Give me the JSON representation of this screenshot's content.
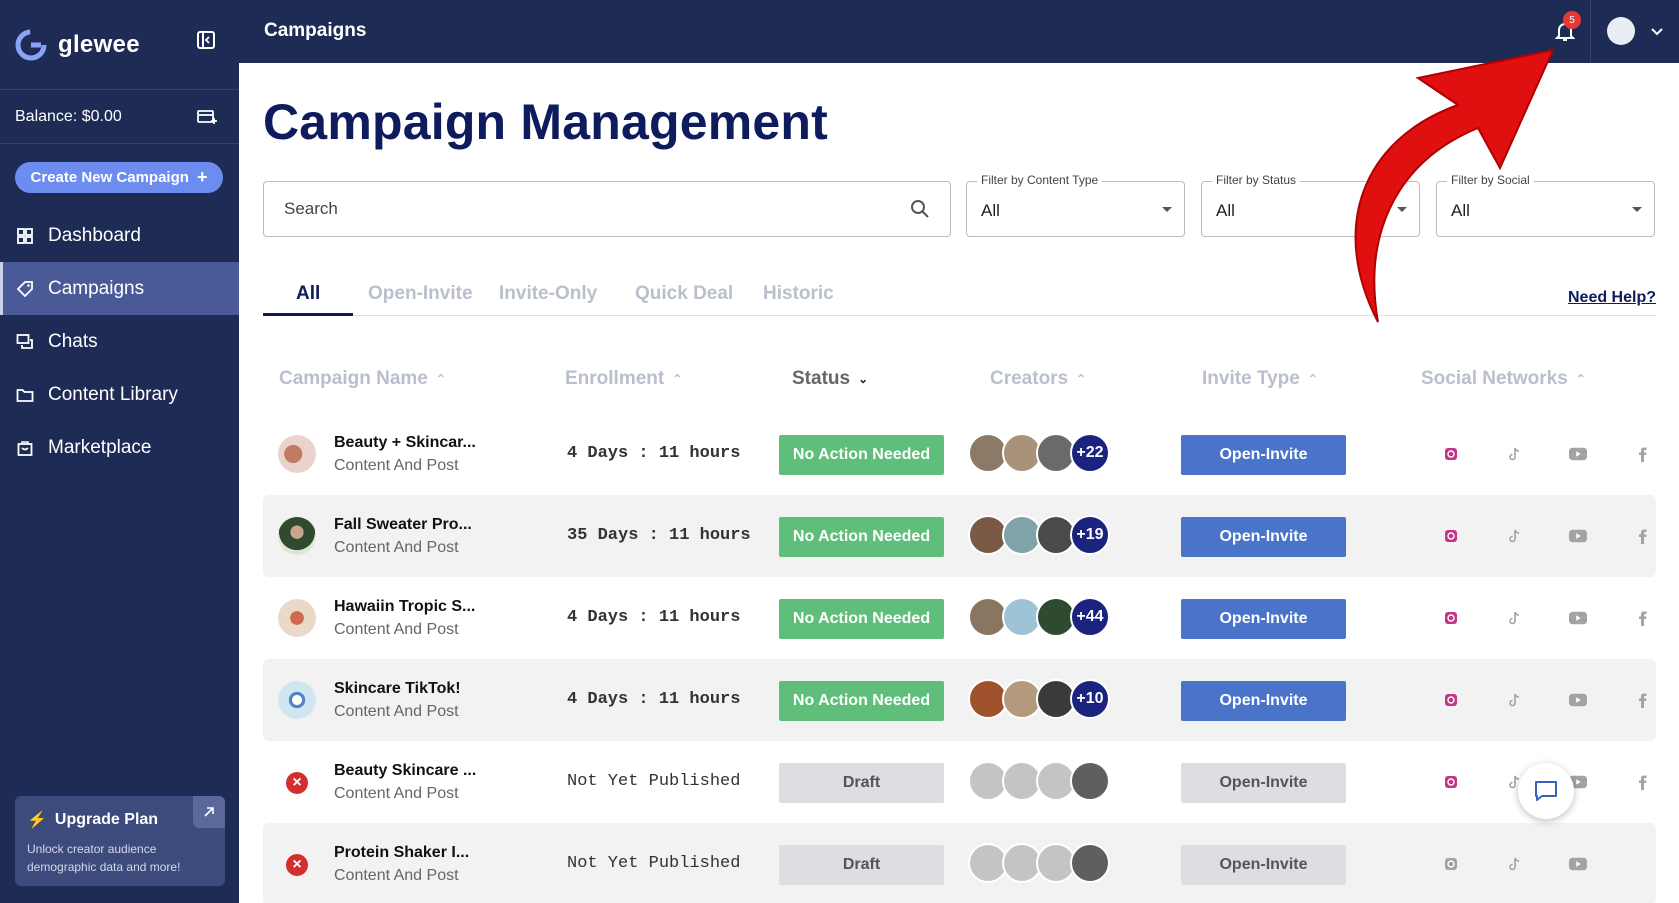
{
  "brand": {
    "name": "glewee"
  },
  "sidebar": {
    "balance": "Balance: $0.00",
    "create_label": "Create New Campaign",
    "items": [
      {
        "label": "Dashboard",
        "icon": "grid-icon"
      },
      {
        "label": "Campaigns",
        "icon": "tag-icon",
        "active": true
      },
      {
        "label": "Chats",
        "icon": "chat-icon"
      },
      {
        "label": "Content Library",
        "icon": "folder-icon"
      },
      {
        "label": "Marketplace",
        "icon": "bag-icon"
      }
    ],
    "upgrade": {
      "title": "Upgrade Plan",
      "text": "Unlock creator audience demographic data and more!"
    }
  },
  "topbar": {
    "title": "Campaigns",
    "notification_count": "5"
  },
  "main": {
    "title": "Campaign Management",
    "search": {
      "placeholder": "Search"
    },
    "filters": [
      {
        "label": "Filter by Content Type",
        "value": "All"
      },
      {
        "label": "Filter by Status",
        "value": "All"
      },
      {
        "label": "Filter by Social",
        "value": "All"
      }
    ],
    "tabs": [
      "All",
      "Open-Invite",
      "Invite-Only",
      "Quick Deal",
      "Historic"
    ],
    "help": "Need Help?",
    "columns": [
      "Campaign Name",
      "Enrollment",
      "Status",
      "Creators",
      "Invite Type",
      "Social Networks"
    ]
  },
  "rows": [
    {
      "name": "Beauty + Skincar...",
      "sub": "Content And Post",
      "enroll": "4 Days : 11 hours",
      "status": "No Action Needed",
      "creators_more": "+22",
      "invite": "Open-Invite"
    },
    {
      "name": "Fall Sweater Pro...",
      "sub": "Content And Post",
      "enroll": "35 Days : 11 hours",
      "status": "No Action Needed",
      "creators_more": "+19",
      "invite": "Open-Invite"
    },
    {
      "name": "Hawaiin Tropic S...",
      "sub": "Content And Post",
      "enroll": "4 Days : 11 hours",
      "status": "No Action Needed",
      "creators_more": "+44",
      "invite": "Open-Invite"
    },
    {
      "name": "Skincare TikTok!",
      "sub": "Content And Post",
      "enroll": "4 Days : 11 hours",
      "status": "No Action Needed",
      "creators_more": "+10",
      "invite": "Open-Invite"
    },
    {
      "name": "Beauty Skincare ...",
      "sub": "Content And Post",
      "enroll": "Not Yet Published",
      "status": "Draft",
      "creators_more": "",
      "invite": "Open-Invite"
    },
    {
      "name": "Protein Shaker I...",
      "sub": "Content And Post",
      "enroll": "Not Yet Published",
      "status": "Draft",
      "creators_more": "",
      "invite": "Open-Invite"
    }
  ],
  "colors": {
    "navy": "#1d2b55",
    "accent": "#6c8cf0",
    "status_green": "#5fbf7a",
    "invite_blue": "#4a74c9",
    "arrow_red": "#e01010"
  }
}
